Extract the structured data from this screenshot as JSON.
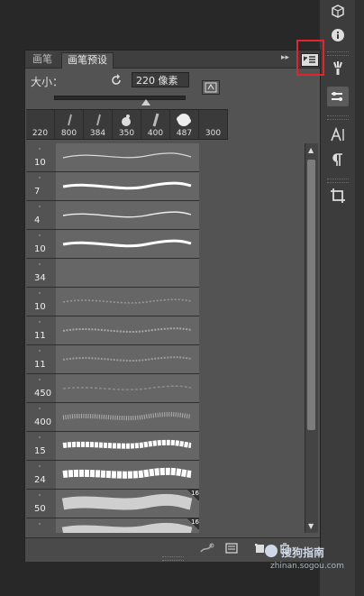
{
  "panel": {
    "tabs": [
      "画笔",
      "画笔预设"
    ],
    "size_label": "大小：",
    "size_value": "220 像素"
  },
  "thumbnails": [
    "220",
    "800",
    "384",
    "350",
    "400",
    "487",
    "300"
  ],
  "brushes": [
    {
      "size": "10",
      "stroke": "thin"
    },
    {
      "size": "7",
      "stroke": "bold"
    },
    {
      "size": "4",
      "stroke": "thin"
    },
    {
      "size": "10",
      "stroke": "bold"
    },
    {
      "size": "34",
      "stroke": "none"
    },
    {
      "size": "10",
      "stroke": "dotted"
    },
    {
      "size": "11",
      "stroke": "dotted"
    },
    {
      "size": "11",
      "stroke": "dotted"
    },
    {
      "size": "450",
      "stroke": "faint"
    },
    {
      "size": "400",
      "stroke": "speckle"
    },
    {
      "size": "15",
      "stroke": "rough"
    },
    {
      "size": "24",
      "stroke": "rough"
    },
    {
      "size": "50",
      "stroke": "chalk",
      "badge": "16"
    },
    {
      "size": "",
      "stroke": "chalk",
      "badge": "16"
    }
  ],
  "watermark": {
    "brand": "搜狗指南",
    "url": "zhinan.sogou.com"
  },
  "colors": {
    "panel": "#535353",
    "highlight_box": "#e0262a"
  }
}
